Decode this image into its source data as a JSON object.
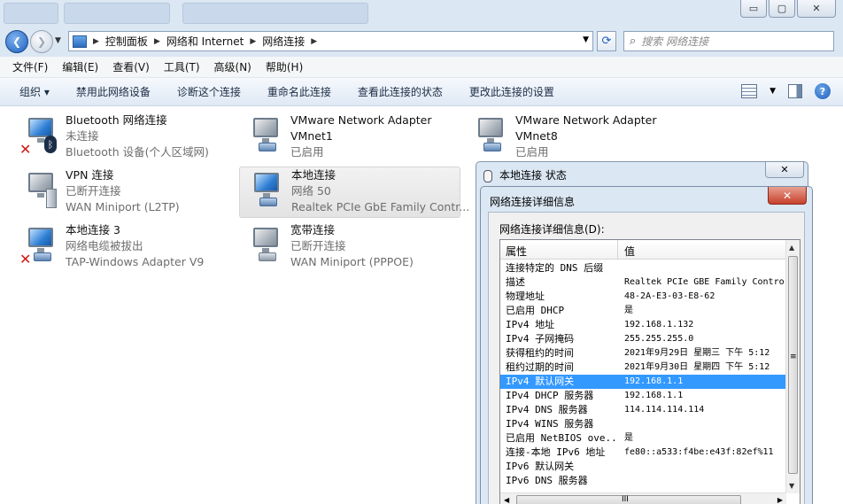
{
  "window": {
    "blurred_tabs": [
      "",
      "",
      ""
    ],
    "min_glyph": "▭",
    "max_glyph": "▢",
    "close_glyph": "✕"
  },
  "address": {
    "crumbs": [
      "控制面板",
      "网络和 Internet",
      "网络连接"
    ],
    "search_placeholder": "搜索 网络连接"
  },
  "menu": [
    "文件(F)",
    "编辑(E)",
    "查看(V)",
    "工具(T)",
    "高级(N)",
    "帮助(H)"
  ],
  "toolbar": {
    "organize": "组织 ▾",
    "commands": [
      "禁用此网络设备",
      "诊断这个连接",
      "重命名此连接",
      "查看此连接的状态",
      "更改此连接的设置"
    ],
    "help": "?"
  },
  "connections": [
    {
      "name": "Bluetooth 网络连接",
      "status": "未连接",
      "device": "Bluetooth 设备(个人区域网)"
    },
    {
      "name": "VMware Network Adapter",
      "status": "VMnet1",
      "device": "已启用"
    },
    {
      "name": "VMware Network Adapter",
      "status": "VMnet8",
      "device": "已启用"
    },
    {
      "name": "VPN 连接",
      "status": "已断开连接",
      "device": "WAN Miniport (L2TP)"
    },
    {
      "name": "本地连接",
      "status": "网络  50",
      "device": "Realtek PCIe GbE Family Contr..."
    },
    {
      "name": "本地连接 3",
      "status": "网络电缆被拔出",
      "device": "TAP-Windows Adapter V9"
    },
    {
      "name": "宽带连接",
      "status": "已断开连接",
      "device": "WAN Miniport (PPPOE)"
    }
  ],
  "status_dialog": {
    "title": "本地连接 状态",
    "close": "✕"
  },
  "details_dialog": {
    "title": "网络连接详细信息",
    "close": "✕",
    "label": "网络连接详细信息(D):",
    "col_property": "属性",
    "col_value": "值",
    "rows": [
      {
        "p": "连接特定的 DNS 后缀",
        "v": ""
      },
      {
        "p": "描述",
        "v": "Realtek PCIe GBE Family Contro"
      },
      {
        "p": "物理地址",
        "v": "48-2A-E3-03-E8-62"
      },
      {
        "p": "已启用 DHCP",
        "v": "是"
      },
      {
        "p": "IPv4 地址",
        "v": "192.168.1.132"
      },
      {
        "p": "IPv4 子网掩码",
        "v": "255.255.255.0"
      },
      {
        "p": "获得租约的时间",
        "v": "2021年9月29日 星期三 下午 5:12"
      },
      {
        "p": "租约过期的时间",
        "v": "2021年9月30日 星期四 下午 5:12"
      },
      {
        "p": "IPv4 默认网关",
        "v": "192.168.1.1"
      },
      {
        "p": "IPv4 DHCP 服务器",
        "v": "192.168.1.1"
      },
      {
        "p": "IPv4 DNS 服务器",
        "v": "114.114.114.114"
      },
      {
        "p": "IPv4 WINS 服务器",
        "v": ""
      },
      {
        "p": "已启用 NetBIOS ove...",
        "v": "是"
      },
      {
        "p": "连接-本地 IPv6 地址",
        "v": "fe80::a533:f4be:e43f:82ef%11"
      },
      {
        "p": "IPv6 默认网关",
        "v": ""
      },
      {
        "p": "IPv6 DNS 服务器",
        "v": ""
      }
    ],
    "selected_row_index": 8,
    "hscroll_grip": "III",
    "vscroll_grip": "≡"
  }
}
